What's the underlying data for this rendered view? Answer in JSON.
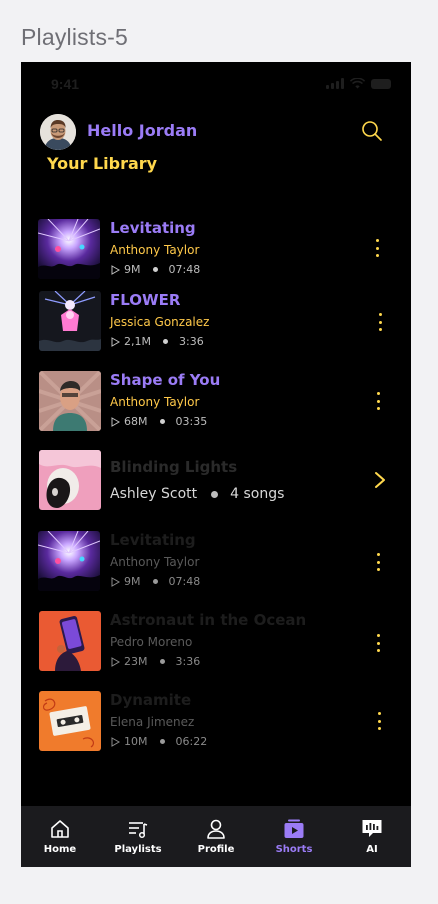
{
  "frame": {
    "title": "Playlists-5"
  },
  "status": {
    "time": "9:41"
  },
  "header": {
    "greeting": "Hello Jordan",
    "library_title": "Your Library"
  },
  "tracks": [
    {
      "title": "Levitating",
      "artist": "Anthony Taylor",
      "plays": "9M",
      "duration": "07:48",
      "state": "active"
    },
    {
      "title": "FLOWER",
      "artist": "Jessica Gonzalez",
      "plays": "2,1M",
      "duration": "3:36",
      "state": "active"
    },
    {
      "title": "Shape of You",
      "artist": "Anthony Taylor",
      "plays": "68M",
      "duration": "03:35",
      "state": "active"
    },
    {
      "title": "Blinding Lights",
      "artist": "Ashley Scott",
      "songs": "4 songs",
      "state": "album"
    },
    {
      "title": "Levitating",
      "artist": "Anthony Taylor",
      "plays": "9M",
      "duration": "07:48",
      "state": "dim"
    },
    {
      "title": "Astronaut in the Ocean",
      "artist": "Pedro Moreno",
      "plays": "23M",
      "duration": "3:36",
      "state": "dim"
    },
    {
      "title": "Dynamite",
      "artist": "Elena Jimenez",
      "plays": "10M",
      "duration": "06:22",
      "state": "dim"
    }
  ],
  "tabbar": [
    {
      "label": "Home",
      "icon": "home-icon"
    },
    {
      "label": "Playlists",
      "icon": "playlist-icon"
    },
    {
      "label": "Profile",
      "icon": "user-icon"
    },
    {
      "label": "Shorts",
      "icon": "play-box-icon",
      "selected": true
    },
    {
      "label": "AI",
      "icon": "chat-ai-icon"
    }
  ],
  "colors": {
    "accent_purple": "#9b7cf6",
    "accent_yellow": "#ffd84d",
    "background": "#000000",
    "tabbar_bg": "#1b1b1e"
  }
}
